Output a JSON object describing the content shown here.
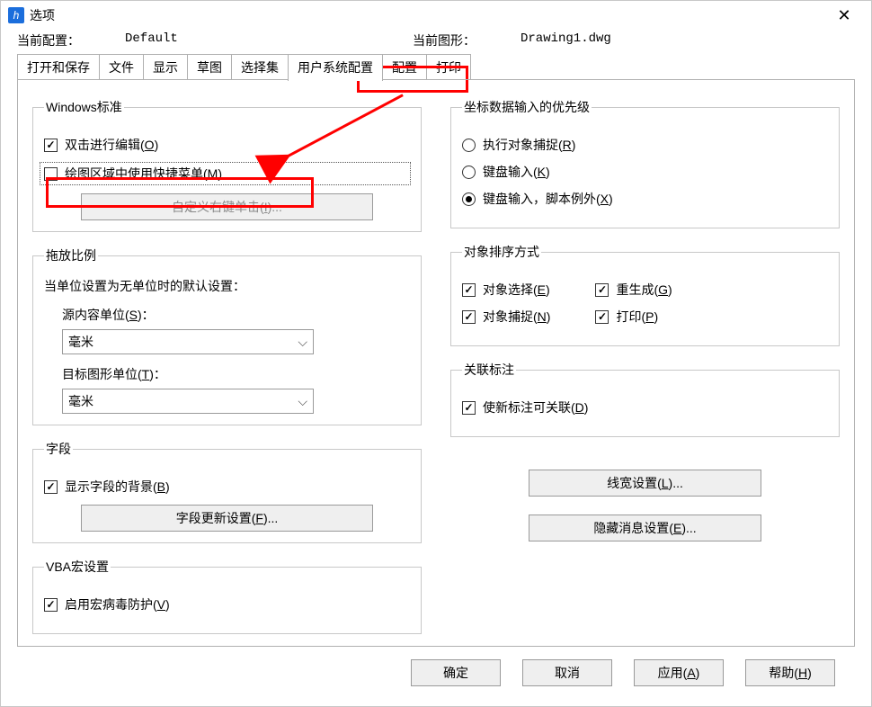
{
  "window": {
    "title": "选项"
  },
  "profile": {
    "label": "当前配置：",
    "value": "Default",
    "drawing_label": "当前图形：",
    "drawing_value": "Drawing1.dwg"
  },
  "tabs": [
    {
      "label": "打开和保存"
    },
    {
      "label": "文件"
    },
    {
      "label": "显示"
    },
    {
      "label": "草图"
    },
    {
      "label": "选择集"
    },
    {
      "label": "用户系统配置",
      "active": true
    },
    {
      "label": "配置"
    },
    {
      "label": "打印"
    }
  ],
  "left": {
    "windows_std": {
      "legend": "Windows标准",
      "dblclick_edit": {
        "label": "双击进行编辑(O)",
        "checked": true,
        "hotkey": "O"
      },
      "ctx_menu": {
        "label": "绘图区域中使用快捷菜单(M)",
        "checked": false,
        "hotkey": "M"
      },
      "custom_rclick_btn": {
        "label": "自定义右键单击(I)...",
        "enabled": false,
        "hotkey": "I"
      }
    },
    "scale": {
      "legend": "拖放比例",
      "hint": "当单位设置为无单位时的默认设置：",
      "src_unit_label": "源内容单位(S)：",
      "src_unit_value": "毫米",
      "src_hotkey": "S",
      "tgt_unit_label": "目标图形单位(T)：",
      "tgt_unit_value": "毫米",
      "tgt_hotkey": "T"
    },
    "field": {
      "legend": "字段",
      "show_bg": {
        "label": "显示字段的背景(B)",
        "checked": true,
        "hotkey": "B"
      },
      "update_btn": {
        "label": "字段更新设置(F)...",
        "hotkey": "F"
      }
    },
    "vba": {
      "legend": "VBA宏设置",
      "virus": {
        "label": "启用宏病毒防护(V)",
        "checked": true,
        "hotkey": "V"
      }
    }
  },
  "right": {
    "coord": {
      "legend": "坐标数据输入的优先级",
      "obj_snap": {
        "label": "执行对象捕捉(R)",
        "hotkey": "R"
      },
      "kb_input": {
        "label": "键盘输入(K)",
        "hotkey": "K"
      },
      "kb_scriptexcept": {
        "label": "键盘输入，脚本例外(X)",
        "hotkey": "X"
      },
      "selected": "kb_scriptexcept"
    },
    "sort": {
      "legend": "对象排序方式",
      "sel": {
        "label": "对象选择(E)",
        "checked": true,
        "hotkey": "E"
      },
      "regen": {
        "label": "重生成(G)",
        "checked": true,
        "hotkey": "G"
      },
      "snap": {
        "label": "对象捕捉(N)",
        "checked": true,
        "hotkey": "N"
      },
      "print": {
        "label": "打印(P)",
        "checked": true,
        "hotkey": "P"
      }
    },
    "assoc": {
      "legend": "关联标注",
      "new_assoc": {
        "label": "使新标注可关联(D)",
        "checked": true,
        "hotkey": "D"
      }
    },
    "lineweight_btn": {
      "label": "线宽设置(L)...",
      "hotkey": "L"
    },
    "hidemsg_btn": {
      "label": "隐藏消息设置(E)...",
      "hotkey": "E"
    }
  },
  "buttons": {
    "ok": "确定",
    "cancel": "取消",
    "apply": {
      "label": "应用(A)",
      "hotkey": "A"
    },
    "help": {
      "label": "帮助(H)",
      "hotkey": "H"
    }
  }
}
